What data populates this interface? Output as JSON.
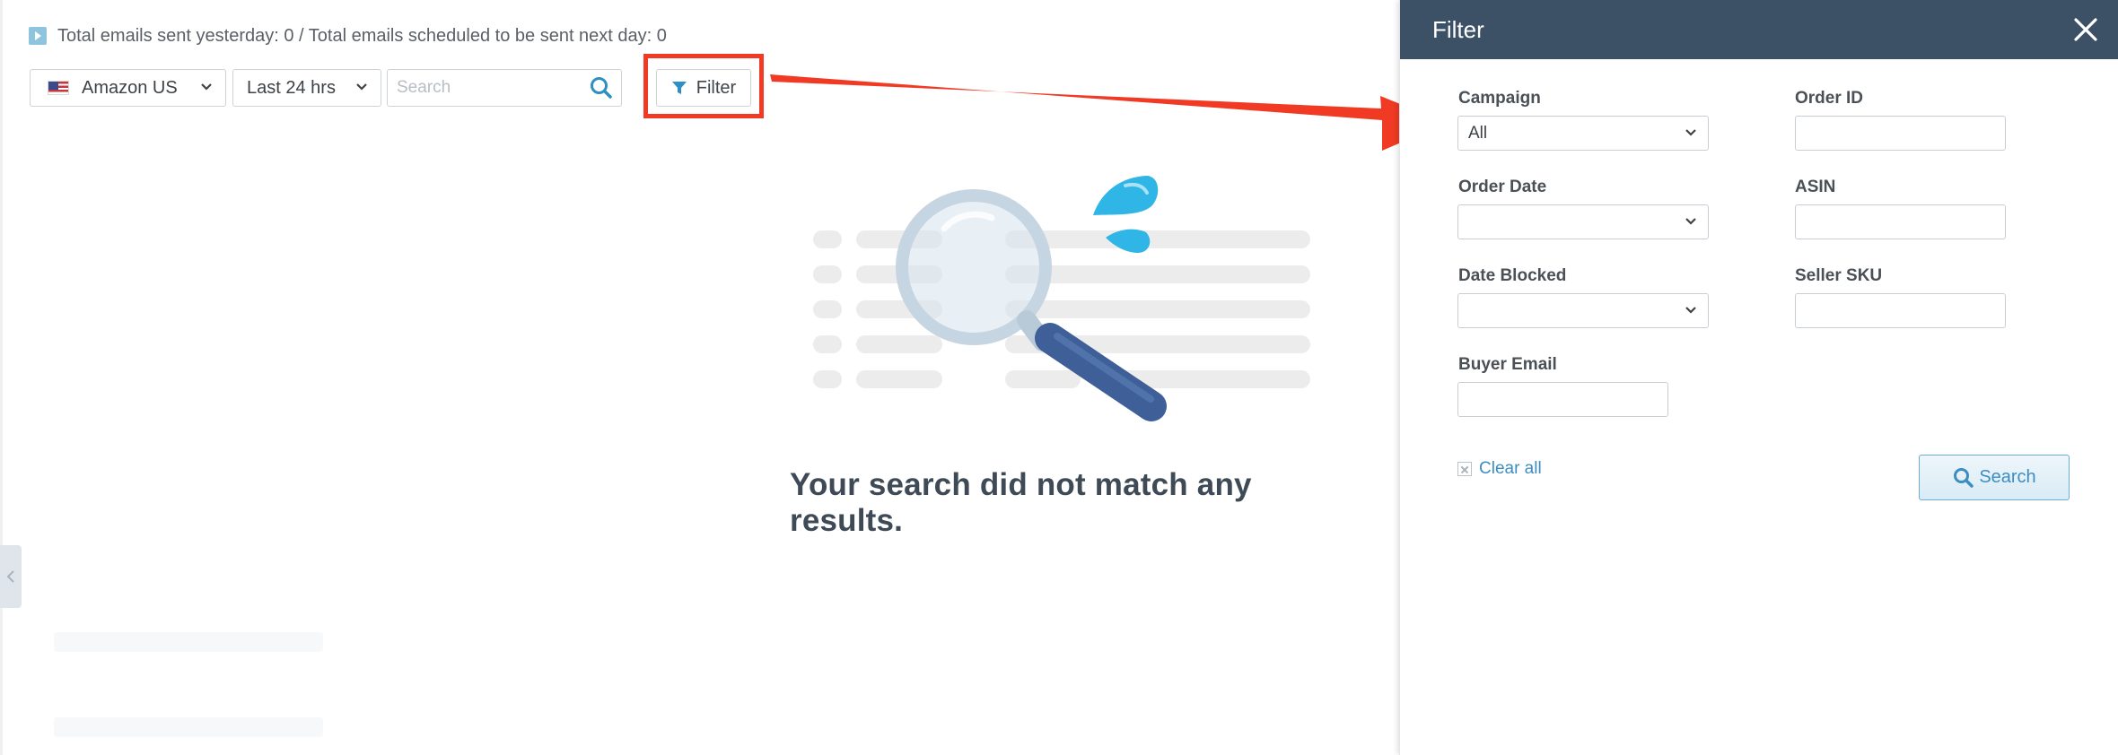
{
  "status": {
    "text": "Total emails sent yesterday: 0 / Total emails scheduled to be sent next day: 0"
  },
  "toolbar": {
    "marketplace": "Amazon US",
    "range": "Last 24 hrs",
    "search_placeholder": "Search",
    "filter_label": "Filter"
  },
  "empty_state": {
    "message": "Your search did not match any results."
  },
  "filter_panel": {
    "title": "Filter",
    "campaign_label": "Campaign",
    "campaign_value": "All",
    "order_id_label": "Order ID",
    "order_date_label": "Order Date",
    "asin_label": "ASIN",
    "date_blocked_label": "Date Blocked",
    "seller_sku_label": "Seller SKU",
    "buyer_email_label": "Buyer Email",
    "clear_all_label": "Clear all",
    "search_label": "Search"
  },
  "colors": {
    "panel_header": "#3d5166",
    "annotation_red": "#f03a24",
    "accent_blue": "#3e8dc0"
  }
}
